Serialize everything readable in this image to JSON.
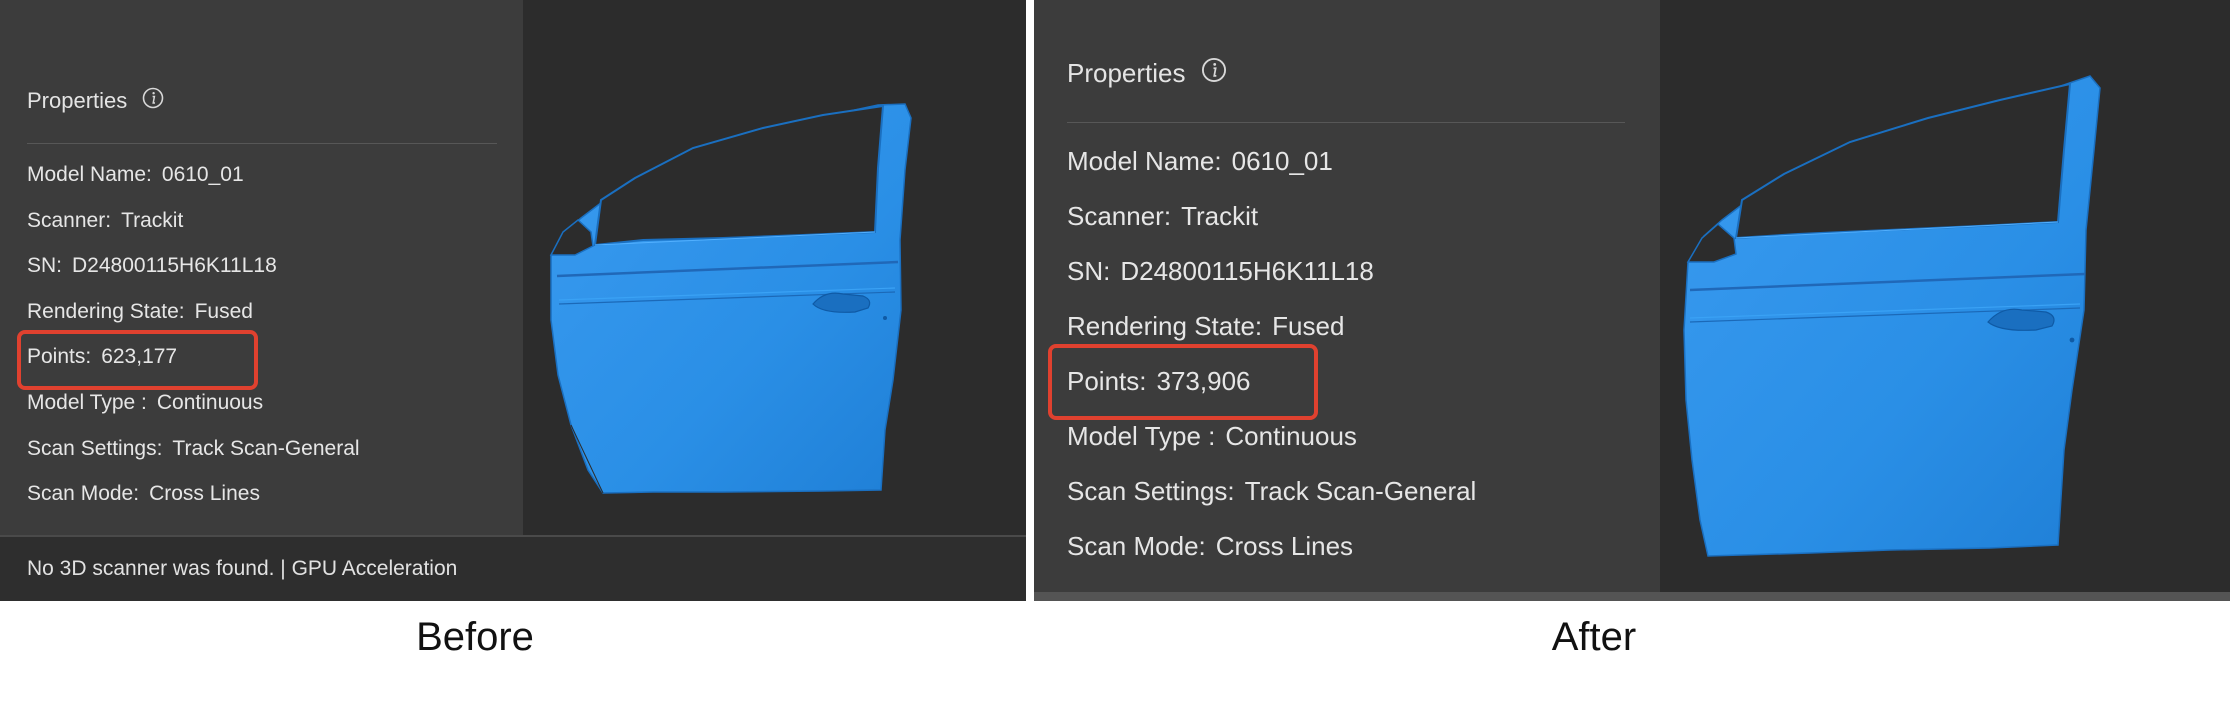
{
  "before": {
    "properties_title": "Properties",
    "model_name_key": "Model Name:",
    "model_name_value": "0610_01",
    "scanner_key": "Scanner:",
    "scanner_value": "Trackit",
    "sn_key": "SN:",
    "sn_value": "D24800115H6K11L18",
    "rendering_key": "Rendering State:",
    "rendering_value": "Fused",
    "points_key": "Points:",
    "points_value": "623,177",
    "model_type_key": "Model Type :",
    "model_type_value": "Continuous",
    "scan_settings_key": "Scan Settings:",
    "scan_settings_value": "Track Scan-General",
    "scan_mode_key": "Scan Mode:",
    "scan_mode_value": "Cross Lines",
    "status_text": "No 3D scanner was found.  | GPU Acceleration",
    "caption": "Before"
  },
  "after": {
    "properties_title": "Properties",
    "model_name_key": "Model Name:",
    "model_name_value": "0610_01",
    "scanner_key": "Scanner:",
    "scanner_value": "Trackit",
    "sn_key": "SN:",
    "sn_value": "D24800115H6K11L18",
    "rendering_key": "Rendering State:",
    "rendering_value": "Fused",
    "points_key": "Points:",
    "points_value": "373,906",
    "model_type_key": "Model Type :",
    "model_type_value": "Continuous",
    "scan_settings_key": "Scan Settings:",
    "scan_settings_value": "Track Scan-General",
    "scan_mode_key": "Scan Mode:",
    "scan_mode_value": "Cross Lines",
    "caption": "After"
  },
  "colors": {
    "scan_blue": "#2a8fe6",
    "highlight_red": "#e0412f",
    "panel_bg": "#3c3c3c",
    "viewport_bg": "#2c2c2c"
  },
  "icons": {
    "properties_info": "info-icon",
    "model": "car-door-scan"
  }
}
